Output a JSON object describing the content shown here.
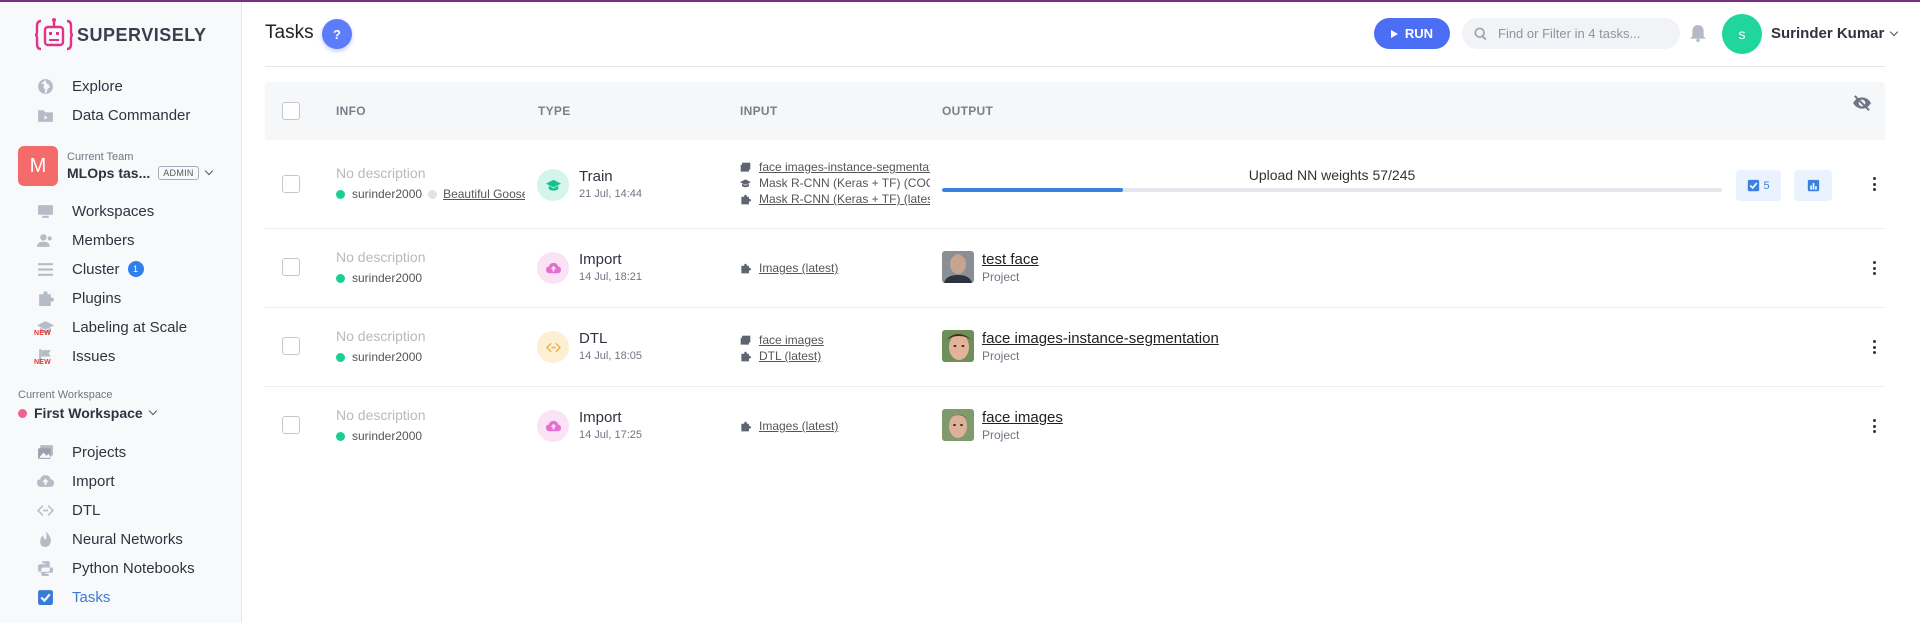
{
  "app": {
    "brand": "SUPERVISELY",
    "accent": "#4c6ef5"
  },
  "sidebar": {
    "top_items": [
      {
        "label": "Explore",
        "icon": "globe-icon"
      },
      {
        "label": "Data Commander",
        "icon": "folder-icon"
      }
    ],
    "team": {
      "caption": "Current Team",
      "avatar_letter": "M",
      "name": "MLOps tas...",
      "role": "ADMIN"
    },
    "team_items": [
      {
        "label": "Workspaces",
        "icon": "monitor-icon"
      },
      {
        "label": "Members",
        "icon": "users-icon"
      },
      {
        "label": "Cluster",
        "icon": "list-icon",
        "badge": "1"
      },
      {
        "label": "Plugins",
        "icon": "puzzle-icon"
      },
      {
        "label": "Labeling at Scale",
        "icon": "graduation-cap-icon",
        "tag": "NEW"
      },
      {
        "label": "Issues",
        "icon": "flag-icon",
        "tag": "NEW"
      }
    ],
    "workspace": {
      "caption": "Current Workspace",
      "name": "First Workspace"
    },
    "workspace_items": [
      {
        "label": "Projects",
        "icon": "images-icon"
      },
      {
        "label": "Import",
        "icon": "cloud-upload-icon"
      },
      {
        "label": "DTL",
        "icon": "code-icon"
      },
      {
        "label": "Neural Networks",
        "icon": "flame-icon"
      },
      {
        "label": "Python Notebooks",
        "icon": "python-icon"
      },
      {
        "label": "Tasks",
        "icon": "check-square-icon",
        "active": true
      }
    ]
  },
  "header": {
    "title": "Tasks",
    "help_label": "?",
    "run_label": "RUN",
    "search_placeholder": "Find or Filter in 4 tasks...",
    "user_initial": "s",
    "user_name": "Surinder Kumar"
  },
  "table": {
    "columns": {
      "info": "INFO",
      "type": "TYPE",
      "input": "INPUT",
      "output": "OUTPUT"
    },
    "rows": [
      {
        "description": "No description",
        "owner": "surinder2000",
        "session": "Beautiful Goose",
        "type": "Train",
        "date": "21 Jul, 14:44",
        "inputs": [
          {
            "icon": "images-icon",
            "text": "face images-instance-segmentation",
            "link": true
          },
          {
            "icon": "graduation-cap-icon",
            "text": "Mask R-CNN (Keras + TF) (COCO)",
            "link": false
          },
          {
            "icon": "puzzle-icon",
            "text": "Mask R-CNN (Keras + TF) (latest)",
            "link": true
          }
        ],
        "progress": {
          "label": "Upload NN weights 57/245",
          "current": 57,
          "total": 245
        },
        "checkpoints": "5"
      },
      {
        "description": "No description",
        "owner": "surinder2000",
        "type": "Import",
        "date": "14 Jul, 18:21",
        "inputs": [
          {
            "icon": "puzzle-icon",
            "text": "Images (latest)",
            "link": true
          }
        ],
        "output": {
          "name": "test face",
          "kind": "Project"
        }
      },
      {
        "description": "No description",
        "owner": "surinder2000",
        "type": "DTL",
        "date": "14 Jul, 18:05",
        "inputs": [
          {
            "icon": "images-icon",
            "text": "face images",
            "link": true
          },
          {
            "icon": "puzzle-icon",
            "text": "DTL (latest)",
            "link": true
          }
        ],
        "output": {
          "name": "face images-instance-segmentation",
          "kind": "Project"
        }
      },
      {
        "description": "No description",
        "owner": "surinder2000",
        "type": "Import",
        "date": "14 Jul, 17:25",
        "inputs": [
          {
            "icon": "puzzle-icon",
            "text": "Images (latest)",
            "link": true
          }
        ],
        "output": {
          "name": "face images",
          "kind": "Project"
        }
      }
    ]
  }
}
